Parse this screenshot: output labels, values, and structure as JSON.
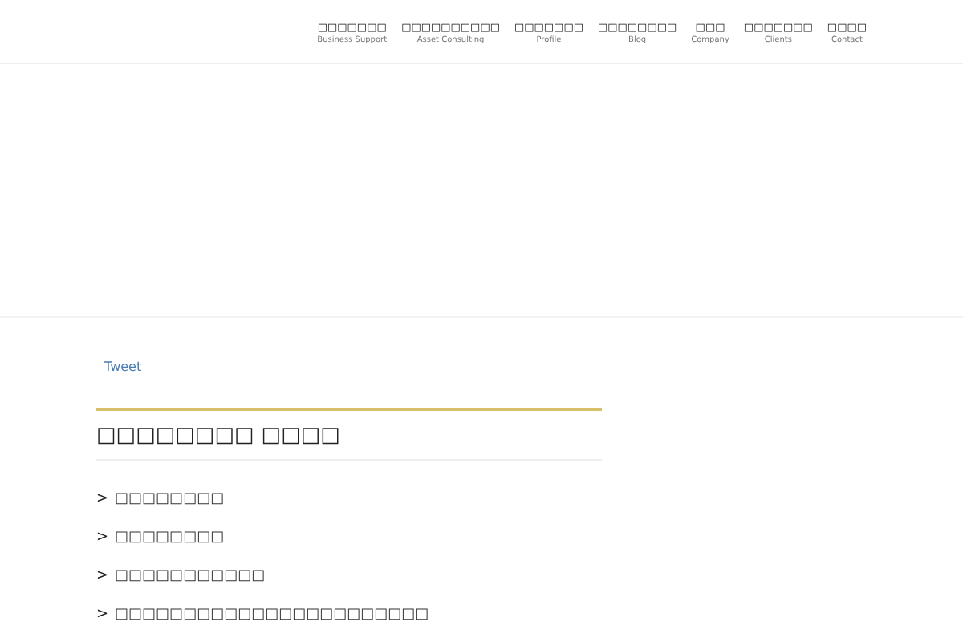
{
  "nav": [
    {
      "label": "□□□□□□□",
      "sub": "Business Support"
    },
    {
      "label": "□□□□□□□□□□",
      "sub": "Asset Consulting"
    },
    {
      "label": "□□□□□□□",
      "sub": "Profile"
    },
    {
      "label": "□□□□□□□□",
      "sub": "Blog"
    },
    {
      "label": "□□□",
      "sub": "Company"
    },
    {
      "label": "□□□□□□□",
      "sub": "Clients"
    },
    {
      "label": "□□□□",
      "sub": "Contact"
    }
  ],
  "tweet": "Tweet",
  "heading": "□□□□□□□□ □□□□",
  "links": [
    {
      "arrow": ">",
      "text": "□□□□□□□□"
    },
    {
      "arrow": ">",
      "text": "□□□□□□□□"
    },
    {
      "arrow": ">",
      "text": "□□□□□□□□□□□"
    },
    {
      "arrow": ">",
      "text": "□□□□□□□□□□□□□□□□□□□□□□□"
    }
  ]
}
